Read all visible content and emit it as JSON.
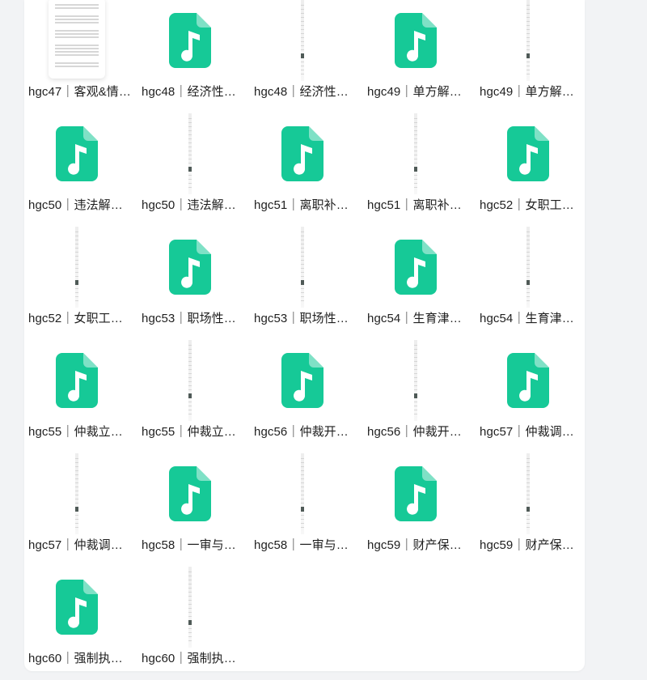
{
  "colors": {
    "audio_icon": "#16c997",
    "page_bg": "#f2f3f5",
    "panel_bg": "#ffffff",
    "text": "#1f1f1f"
  },
  "files": [
    {
      "name": "hgc47｜客观&情…",
      "kind": "document"
    },
    {
      "name": "hgc48｜经济性…",
      "kind": "audio"
    },
    {
      "name": "hgc48｜经济性…",
      "kind": "image-strip"
    },
    {
      "name": "hgc49｜单方解…",
      "kind": "audio"
    },
    {
      "name": "hgc49｜单方解…",
      "kind": "image-strip"
    },
    {
      "name": "hgc50｜违法解…",
      "kind": "audio"
    },
    {
      "name": "hgc50｜违法解…",
      "kind": "image-strip"
    },
    {
      "name": "hgc51｜离职补…",
      "kind": "audio"
    },
    {
      "name": "hgc51｜离职补…",
      "kind": "image-strip"
    },
    {
      "name": "hgc52｜女职工…",
      "kind": "audio"
    },
    {
      "name": "hgc52｜女职工…",
      "kind": "image-strip"
    },
    {
      "name": "hgc53｜职场性…",
      "kind": "audio"
    },
    {
      "name": "hgc53｜职场性…",
      "kind": "image-strip"
    },
    {
      "name": "hgc54｜生育津…",
      "kind": "audio"
    },
    {
      "name": "hgc54｜生育津…",
      "kind": "image-strip"
    },
    {
      "name": "hgc55｜仲裁立…",
      "kind": "audio"
    },
    {
      "name": "hgc55｜仲裁立…",
      "kind": "image-strip"
    },
    {
      "name": "hgc56｜仲裁开…",
      "kind": "audio"
    },
    {
      "name": "hgc56｜仲裁开…",
      "kind": "image-strip"
    },
    {
      "name": "hgc57｜仲裁调…",
      "kind": "audio"
    },
    {
      "name": "hgc57｜仲裁调…",
      "kind": "image-strip"
    },
    {
      "name": "hgc58｜一审与…",
      "kind": "audio"
    },
    {
      "name": "hgc58｜一审与…",
      "kind": "image-strip"
    },
    {
      "name": "hgc59｜财产保…",
      "kind": "audio"
    },
    {
      "name": "hgc59｜财产保…",
      "kind": "image-strip"
    },
    {
      "name": "hgc60｜强制执…",
      "kind": "audio"
    },
    {
      "name": "hgc60｜强制执…",
      "kind": "image-strip"
    }
  ]
}
